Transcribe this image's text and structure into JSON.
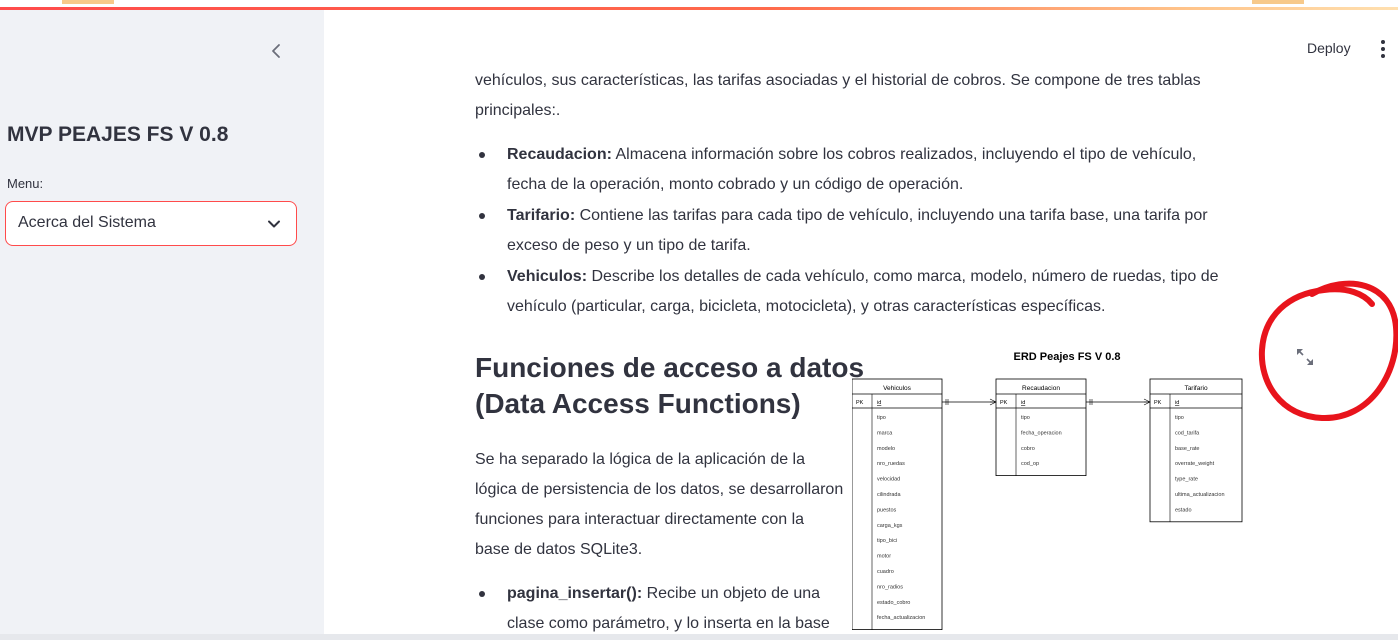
{
  "sidebar": {
    "app_title": "MVP PEAJES FS V 0.8",
    "menu_label": "Menu:",
    "menu_selected": "Acerca del Sistema",
    "collapse_icon": "chevron-left-icon"
  },
  "header": {
    "deploy_label": "Deploy",
    "menu_icon": "vertical-dots-icon"
  },
  "content": {
    "intro_line1": "vehículos, sus características, las tarifas asociadas y el historial de cobros. Se compone de tres tablas",
    "intro_line2": "principales:.",
    "tables": [
      {
        "name": "Recaudacion:",
        "line1": " Almacena información sobre los cobros realizados, incluyendo el tipo de vehículo,",
        "line2": "fecha de la operación, monto cobrado y un código de operación."
      },
      {
        "name": "Tarifario:",
        "line1": " Contiene las tarifas para cada tipo de vehículo, incluyendo una tarifa base, una tarifa por",
        "line2": "exceso de peso y un tipo de tarifa."
      },
      {
        "name": "Vehiculos:",
        "line1": " Describe los detalles de cada vehículo, como marca, modelo, número de ruedas, tipo de",
        "line2": "vehículo (particular, carga, bicicleta, motocicleta), y otras características específicas."
      }
    ],
    "section_heading_line1": "Funciones de acceso a datos",
    "section_heading_line2": "(Data Access Functions)",
    "section_body": [
      "Se ha separado la lógica de la aplicación de la",
      "lógica de persistencia de los datos, se desarrollaron",
      "funciones para interactuar directamente con la",
      "base de datos SQLite3."
    ],
    "functions": [
      {
        "name": "pagina_insertar():",
        "line1": " Recibe un objeto de una",
        "line2": "clase como parámetro, y lo inserta en la base"
      }
    ]
  },
  "erd": {
    "title": "ERD Peajes FS V 0.8",
    "pk_label": "PK",
    "entities": [
      {
        "name": "Vehiculos",
        "pk": "id",
        "fields": [
          "tipo",
          "marca",
          "modelo",
          "nro_ruedas",
          "velocidad",
          "cilindrada",
          "puestos",
          "carga_kgs",
          "tipo_bici",
          "motor",
          "cuadro",
          "nro_radios",
          "estado_cobro",
          "fecha_actualizacion"
        ]
      },
      {
        "name": "Recaudacion",
        "pk": "id",
        "fields": [
          "tipo",
          "fecha_operacion",
          "cobro",
          "cod_op"
        ]
      },
      {
        "name": "Tarifario",
        "pk": "id",
        "fields": [
          "tipo",
          "cod_tarifa",
          "base_rate",
          "overrate_weight",
          "type_rate",
          "ultima_actualizacion",
          "estado"
        ]
      }
    ],
    "fullscreen_icon": "expand-icon"
  },
  "colors": {
    "accent": "#ff4b4b",
    "sidebar_bg": "#f0f2f6",
    "text": "#31333f",
    "annotation": "#e8141c"
  }
}
